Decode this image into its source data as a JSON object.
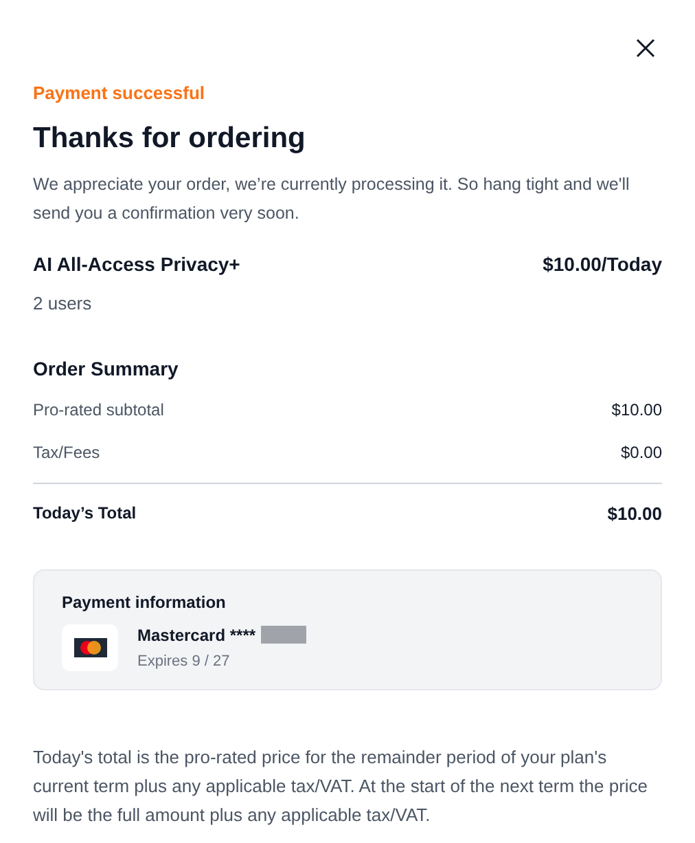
{
  "status": "Payment successful",
  "title": "Thanks for ordering",
  "message": "We appreciate your order, we’re currently processing it. So hang tight and we'll send you a confirmation very soon.",
  "product": {
    "name": "AI All-Access Privacy+",
    "price": "$10.00/Today",
    "users": "2 users"
  },
  "summary": {
    "heading": "Order Summary",
    "rows": [
      {
        "label": "Pro-rated subtotal",
        "value": "$10.00"
      },
      {
        "label": "Tax/Fees",
        "value": "$0.00"
      }
    ],
    "total": {
      "label": "Today’s Total",
      "value": "$10.00"
    }
  },
  "payment": {
    "heading": "Payment information",
    "card": "Mastercard ****",
    "expires": "Expires 9 / 27"
  },
  "note": "Today's total is the pro-rated price for the remainder period of your plan's current term plus any applicable tax/VAT. At the start of the next term the price will be the full amount plus any applicable tax/VAT."
}
